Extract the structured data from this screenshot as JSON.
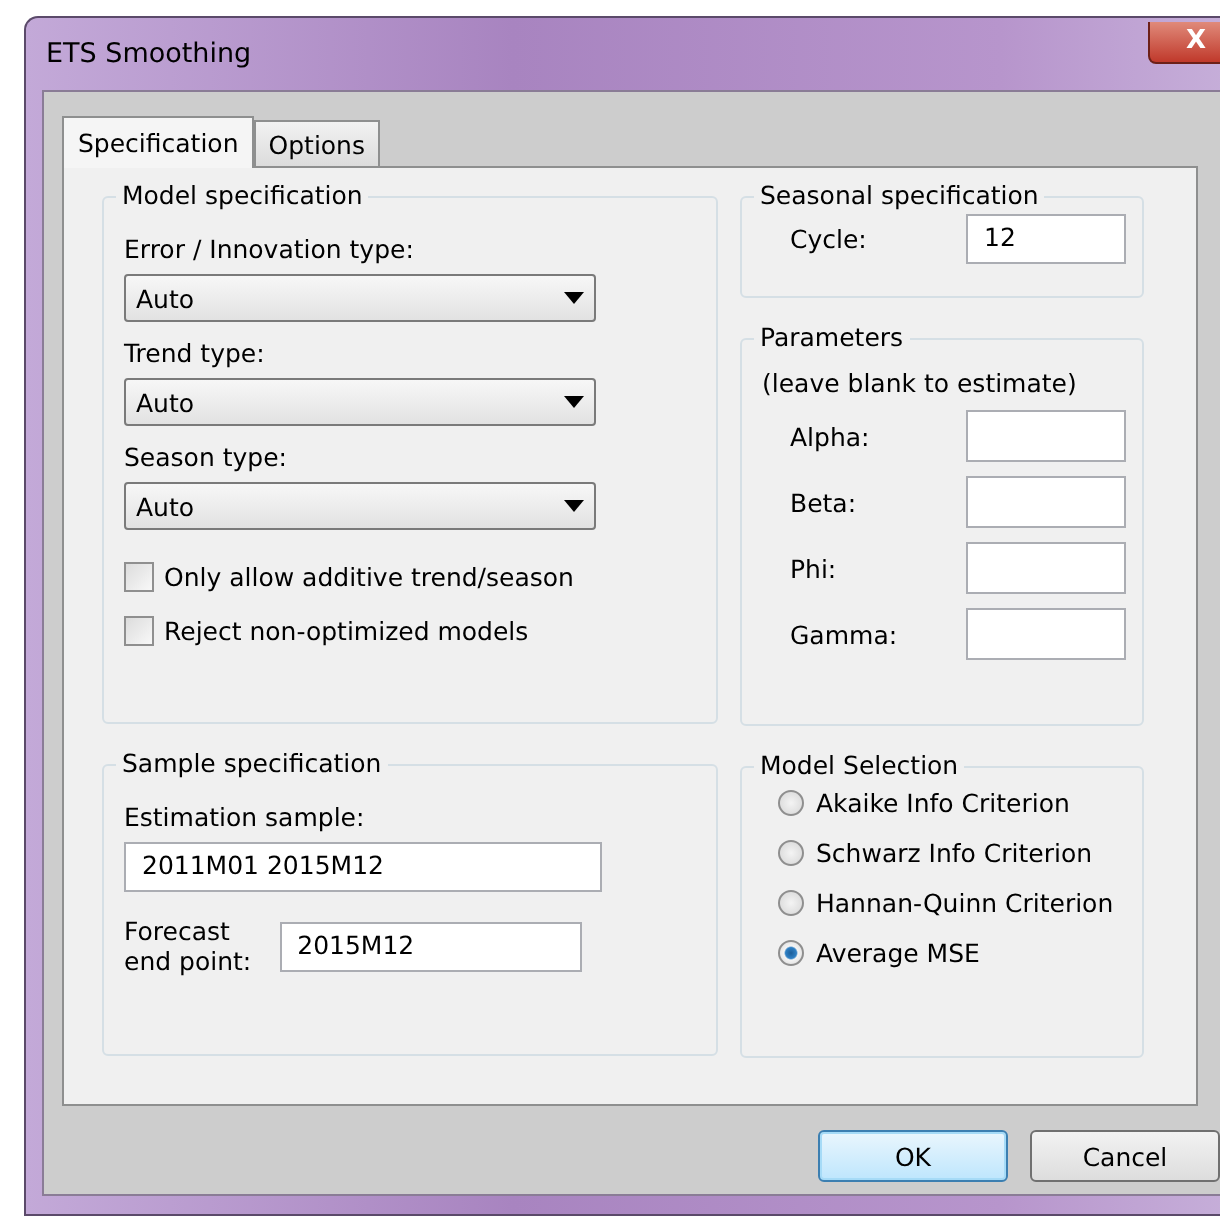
{
  "window": {
    "title": "ETS Smoothing",
    "close_glyph": "X"
  },
  "tabs": [
    {
      "label": "Specification",
      "selected": true
    },
    {
      "label": "Options",
      "selected": false
    }
  ],
  "model_specification": {
    "title": "Model specification",
    "dropdowns": [
      {
        "label": "Error / Innovation type:",
        "value": "Auto"
      },
      {
        "label": "Trend type:",
        "value": "Auto"
      },
      {
        "label": "Season type:",
        "value": "Auto"
      }
    ],
    "checkboxes": [
      {
        "label": "Only allow additive trend/season",
        "checked": false
      },
      {
        "label": "Reject non-optimized models",
        "checked": false
      }
    ]
  },
  "sample_specification": {
    "title": "Sample specification",
    "estimation_label": "Estimation sample:",
    "estimation_value": "2011M01 2015M12",
    "forecast_label": [
      "Forecast",
      "end point:"
    ],
    "forecast_value": "2015M12"
  },
  "seasonal_specification": {
    "title": "Seasonal specification",
    "cycle_label": "Cycle:",
    "cycle_value": "12"
  },
  "parameters": {
    "title": "Parameters",
    "hint": "(leave blank to estimate)",
    "fields": [
      {
        "label": "Alpha:"
      },
      {
        "label": "Beta:"
      },
      {
        "label": "Phi:"
      },
      {
        "label": "Gamma:"
      }
    ]
  },
  "model_selection": {
    "title": "Model Selection",
    "options": [
      {
        "label": "Akaike Info Criterion",
        "selected": false
      },
      {
        "label": "Schwarz Info Criterion",
        "selected": false
      },
      {
        "label": "Hannan-Quinn Criterion",
        "selected": false
      },
      {
        "label": "Average MSE",
        "selected": true
      }
    ]
  },
  "buttons": [
    {
      "label": "OK",
      "kind": "default"
    },
    {
      "label": "Cancel",
      "kind": "normal"
    }
  ]
}
